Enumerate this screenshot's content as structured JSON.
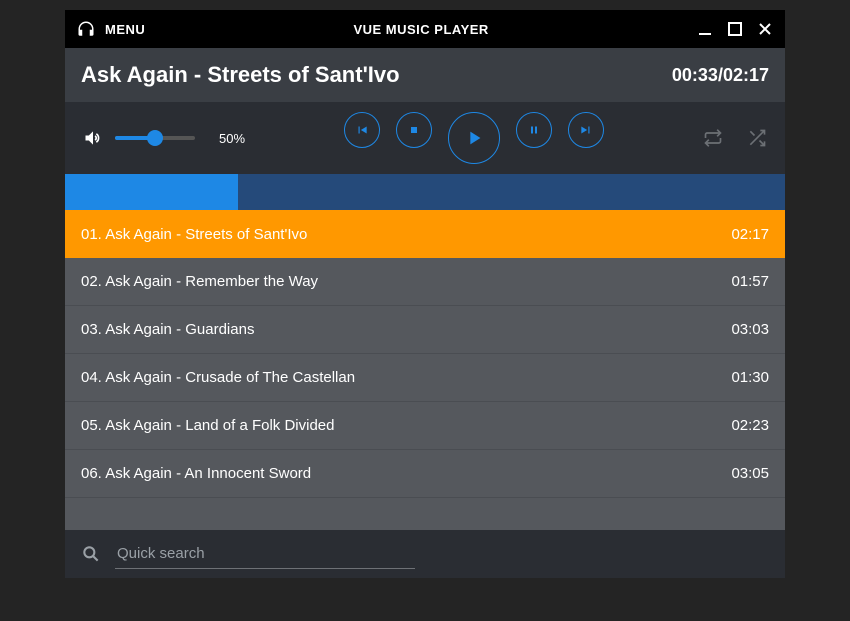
{
  "header": {
    "menu_label": "MENU",
    "app_title": "VUE MUSIC PLAYER"
  },
  "nowplaying": {
    "title": "Ask Again - Streets of Sant'Ivo",
    "elapsed": "00:33",
    "total": "02:17"
  },
  "volume": {
    "percent": 50,
    "label": "50%"
  },
  "progress": {
    "percent": 24
  },
  "playlist": [
    {
      "num": "01",
      "label": "01. Ask Again - Streets of Sant'Ivo",
      "duration": "02:17",
      "active": true
    },
    {
      "num": "02",
      "label": "02. Ask Again - Remember the Way",
      "duration": "01:57",
      "active": false
    },
    {
      "num": "03",
      "label": "03. Ask Again - Guardians",
      "duration": "03:03",
      "active": false
    },
    {
      "num": "04",
      "label": "04. Ask Again - Crusade of The Castellan",
      "duration": "01:30",
      "active": false
    },
    {
      "num": "05",
      "label": "05. Ask Again - Land of a Folk Divided",
      "duration": "02:23",
      "active": false
    },
    {
      "num": "06",
      "label": "06. Ask Again - An Innocent Sword",
      "duration": "03:05",
      "active": false
    }
  ],
  "search": {
    "placeholder": "Quick search"
  },
  "colors": {
    "accent": "#1E88E5",
    "active_track": "#FF9800"
  }
}
